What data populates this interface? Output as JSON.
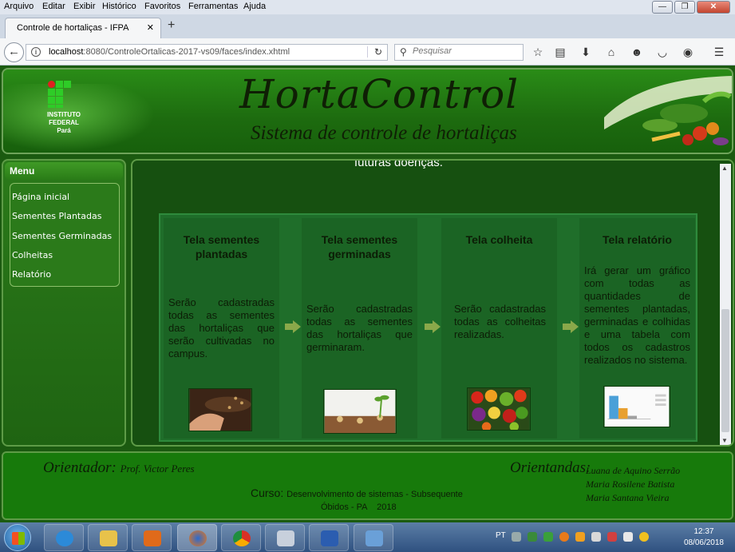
{
  "menubar": [
    "Arquivo",
    "Editar",
    "Exibir",
    "Histórico",
    "Favoritos",
    "Ferramentas",
    "Ajuda"
  ],
  "browser": {
    "tab_title": "Controle de hortaliças - IFPA",
    "url_host": "localhost",
    "url_rest": ":8080/ControleOrtalicas-2017-vs09/faces/index.xhtml",
    "search_placeholder": "Pesquisar"
  },
  "header": {
    "logo_text": [
      "INSTITUTO",
      "FEDERAL",
      "Pará"
    ],
    "title": "HortaControl",
    "subtitle": "Sistema de controle de hortaliças"
  },
  "menu": {
    "heading": "Menu",
    "items": [
      "Página inicial",
      "Sementes Plantadas",
      "Sementes Germinadas",
      "Colheitas",
      "Relatório"
    ]
  },
  "content": {
    "intro_tail": "futuras doenças.",
    "cards": [
      {
        "title": "Tela sementes plantadas",
        "text": "Serão cadastradas todas as sementes das hortaliças que serão cultivadas no campus."
      },
      {
        "title": "Tela sementes germinadas",
        "text": "Serão cadastradas todas as sementes das hortaliças que germinaram."
      },
      {
        "title": "Tela colheita",
        "text": "Serão cadastradas todas as colheitas realizadas."
      },
      {
        "title": "Tela relatório",
        "text": "Irá gerar um gráfico com todas as quantidades de sementes plantadas, germinadas e colhidas e uma tabela com todos os cadastros realizados no sistema."
      }
    ]
  },
  "footer": {
    "orientador_label": "Orientador:",
    "orientador_name": "Prof. Victor Peres",
    "orientandas_label": "Orientandas:",
    "orientandas": [
      "Luana de Aquino Serrão",
      "Maria Rosilene Batista",
      "Maria Santana Vieira"
    ],
    "curso_label": "Curso:",
    "curso": "Desenvolvimento de sistemas - Subsequente",
    "cidade": "Óbidos - PA    2018"
  },
  "taskbar": {
    "lang": "PT",
    "time": "12:37",
    "date": "08/06/2018"
  },
  "colors": {
    "page_bg": "#1b5a10",
    "card_bg": "#1b6424",
    "footer_bg": "#177a0b"
  }
}
